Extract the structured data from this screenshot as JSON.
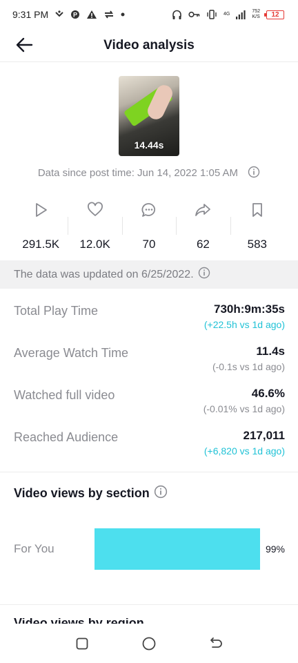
{
  "status_bar": {
    "time": "9:31 PM",
    "net_type": "4G",
    "speed_value": "752",
    "speed_unit": "K/S",
    "battery": "12"
  },
  "header": {
    "title": "Video analysis"
  },
  "video": {
    "duration": "14.44s"
  },
  "since_text": "Data since post time: Jun 14, 2022 1:05 AM",
  "stats": [
    {
      "icon": "play-icon",
      "value": "291.5K"
    },
    {
      "icon": "heart-icon",
      "value": "12.0K"
    },
    {
      "icon": "comment-icon",
      "value": "70"
    },
    {
      "icon": "share-icon",
      "value": "62"
    },
    {
      "icon": "bookmark-icon",
      "value": "583"
    }
  ],
  "update_text": "The data was updated on 6/25/2022.",
  "metrics": [
    {
      "label": "Total Play Time",
      "value": "730h:9m:35s",
      "delta": "(+22.5h vs 1d ago)",
      "trend": "up"
    },
    {
      "label": "Average Watch Time",
      "value": "11.4s",
      "delta": "(-0.1s vs 1d ago)",
      "trend": "down"
    },
    {
      "label": "Watched full video",
      "value": "46.6%",
      "delta": "(-0.01% vs 1d ago)",
      "trend": "down"
    },
    {
      "label": "Reached Audience",
      "value": "217,011",
      "delta": "(+6,820 vs 1d ago)",
      "trend": "up"
    }
  ],
  "views_section": {
    "title": "Video views by section",
    "rows": [
      {
        "label": "For You",
        "percent": 99,
        "percent_label": "99%"
      }
    ]
  },
  "next_section_title": "Video views by region",
  "colors": {
    "accent": "#20c2d6",
    "bar": "#4ddfee",
    "muted": "#8a8b91",
    "battery": "#e53935"
  }
}
